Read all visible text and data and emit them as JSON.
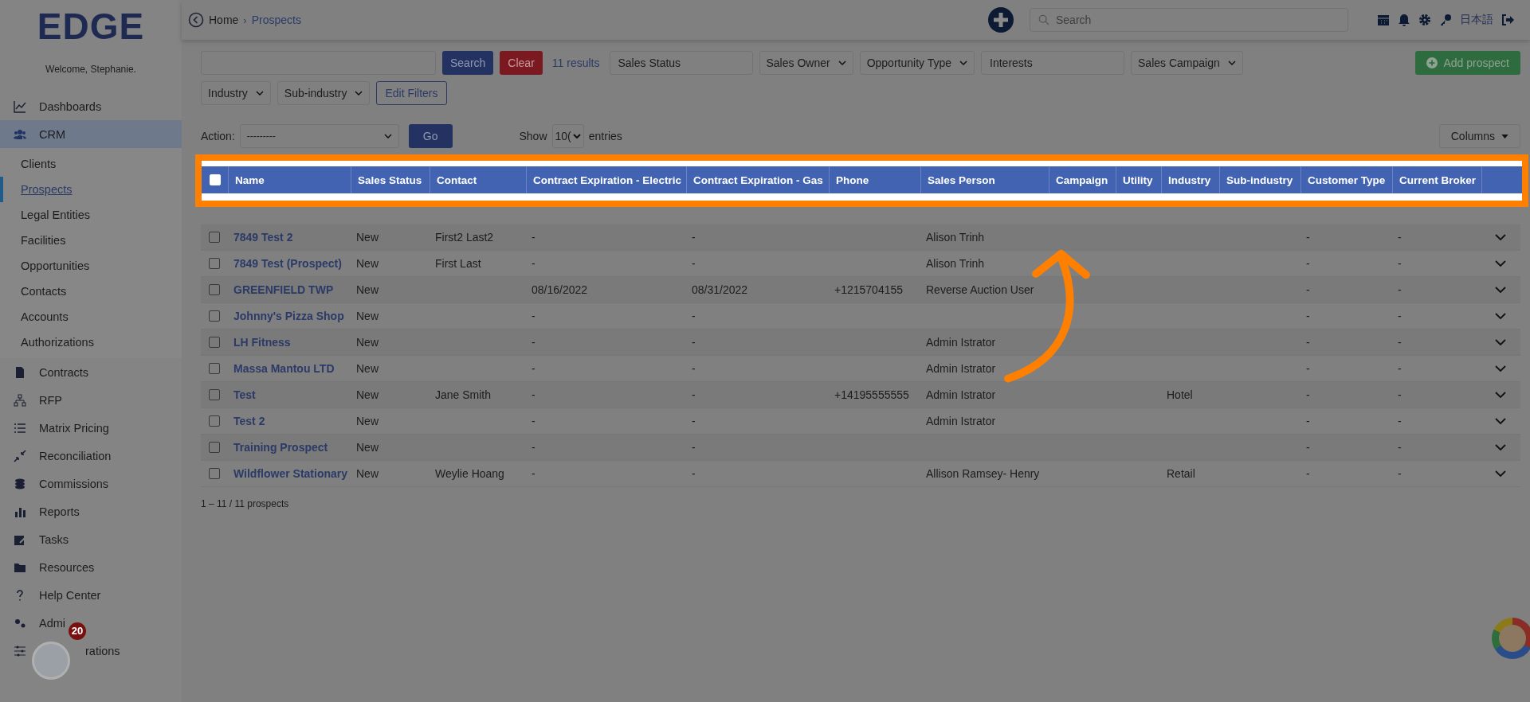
{
  "sidebar": {
    "logo": "EDGE",
    "welcome": "Welcome, Stephanie.",
    "items": [
      {
        "label": "Dashboards",
        "selected": false
      },
      {
        "label": "CRM",
        "selected": true,
        "children": [
          {
            "label": "Clients",
            "selected": false
          },
          {
            "label": "Prospects",
            "selected": true
          },
          {
            "label": "Legal Entities",
            "selected": false
          },
          {
            "label": "Facilities",
            "selected": false
          },
          {
            "label": "Opportunities",
            "selected": false
          },
          {
            "label": "Contacts",
            "selected": false
          },
          {
            "label": "Accounts",
            "selected": false
          },
          {
            "label": "Authorizations",
            "selected": false
          }
        ]
      },
      {
        "label": "Contracts",
        "selected": false
      },
      {
        "label": "RFP",
        "selected": false
      },
      {
        "label": "Matrix Pricing",
        "selected": false
      },
      {
        "label": "Reconciliation",
        "selected": false
      },
      {
        "label": "Commissions",
        "selected": false
      },
      {
        "label": "Reports",
        "selected": false
      },
      {
        "label": "Tasks",
        "selected": false
      },
      {
        "label": "Resources",
        "selected": false
      },
      {
        "label": "Help Center",
        "selected": false
      },
      {
        "label": "Admi",
        "selected": false
      },
      {
        "label": "rations",
        "selected": false
      }
    ],
    "tour_badge": {
      "count": "20"
    }
  },
  "breadcrumb": [
    "Home",
    "›",
    "Prospects"
  ],
  "top_bar": {
    "search": {
      "placeholder": "Search"
    },
    "language": "日本語"
  },
  "filters": {
    "search_button": "Search",
    "clear_button": "Clear",
    "results": "11 results",
    "fields": [
      {
        "kind": "input",
        "placeholder": "Sales Status"
      },
      {
        "kind": "select",
        "label": "Sales Owner"
      },
      {
        "kind": "select",
        "label": "Opportunity Type"
      },
      {
        "kind": "input",
        "placeholder": "Interests"
      },
      {
        "kind": "select",
        "label": "Sales Campaign"
      }
    ],
    "add_button": "Add prospect",
    "second_row": [
      {
        "kind": "select",
        "label": "Industry"
      },
      {
        "kind": "select",
        "label": "Sub-industry"
      },
      {
        "kind": "button",
        "label": "Edit Filters"
      }
    ]
  },
  "actions": {
    "label": "Action:",
    "value": "---------",
    "go": "Go",
    "show": "Show",
    "entries_value": "10(",
    "entries": "entries",
    "columns_button": "Columns"
  },
  "table": {
    "select_all_checked": false,
    "columns": [
      "Name",
      "Sales Status",
      "Contact",
      "Contract Expiration - Electric",
      "Contract Expiration - Gas",
      "Phone",
      "Sales Person",
      "Campaign",
      "Utility",
      "Industry",
      "Sub-industry",
      "Customer Type",
      "Current Broker"
    ],
    "rows": [
      {
        "checked": false,
        "cells": [
          "7849 Test 2",
          "New",
          "First2 Last2",
          "-",
          "-",
          null,
          "Alison Trinh",
          null,
          null,
          null,
          null,
          "-",
          "-"
        ]
      },
      {
        "checked": false,
        "cells": [
          "7849 Test (Prospect)",
          "New",
          "First Last",
          "-",
          "-",
          null,
          "Alison Trinh",
          null,
          null,
          null,
          null,
          "-",
          "-"
        ]
      },
      {
        "checked": false,
        "cells": [
          "GREENFIELD TWP",
          "New",
          null,
          "08/16/2022",
          "08/31/2022",
          "+1215704155",
          "Reverse Auction User",
          null,
          null,
          null,
          null,
          "-",
          "-"
        ]
      },
      {
        "checked": false,
        "cells": [
          "Johnny's Pizza Shop",
          "New",
          null,
          "-",
          "-",
          null,
          null,
          null,
          null,
          null,
          null,
          "-",
          "-"
        ]
      },
      {
        "checked": false,
        "cells": [
          "LH Fitness",
          "New",
          null,
          "-",
          "-",
          null,
          "Admin Istrator",
          null,
          null,
          null,
          null,
          "-",
          "-"
        ]
      },
      {
        "checked": false,
        "cells": [
          "Massa Mantou LTD",
          "New",
          null,
          "-",
          "-",
          null,
          "Admin Istrator",
          null,
          null,
          null,
          null,
          "-",
          "-"
        ]
      },
      {
        "checked": false,
        "cells": [
          "Test",
          "New",
          "Jane Smith",
          "-",
          "-",
          "+14195555555",
          "Admin Istrator",
          null,
          null,
          "Hotel",
          null,
          "-",
          "-"
        ]
      },
      {
        "checked": false,
        "cells": [
          "Test 2",
          "New",
          null,
          "-",
          "-",
          null,
          "Admin Istrator",
          null,
          null,
          null,
          null,
          "-",
          "-"
        ]
      },
      {
        "checked": false,
        "cells": [
          "Training Prospect",
          "New",
          null,
          "-",
          "-",
          null,
          null,
          null,
          null,
          null,
          null,
          "-",
          "-"
        ]
      },
      {
        "checked": false,
        "cells": [
          "Wildflower Stationary",
          "New",
          "Weylie Hoang",
          "-",
          "-",
          null,
          "Allison Ramsey- Henry",
          null,
          null,
          "Retail",
          null,
          "-",
          "-"
        ]
      }
    ],
    "footer": "1 – 11  /  11 prospects"
  }
}
